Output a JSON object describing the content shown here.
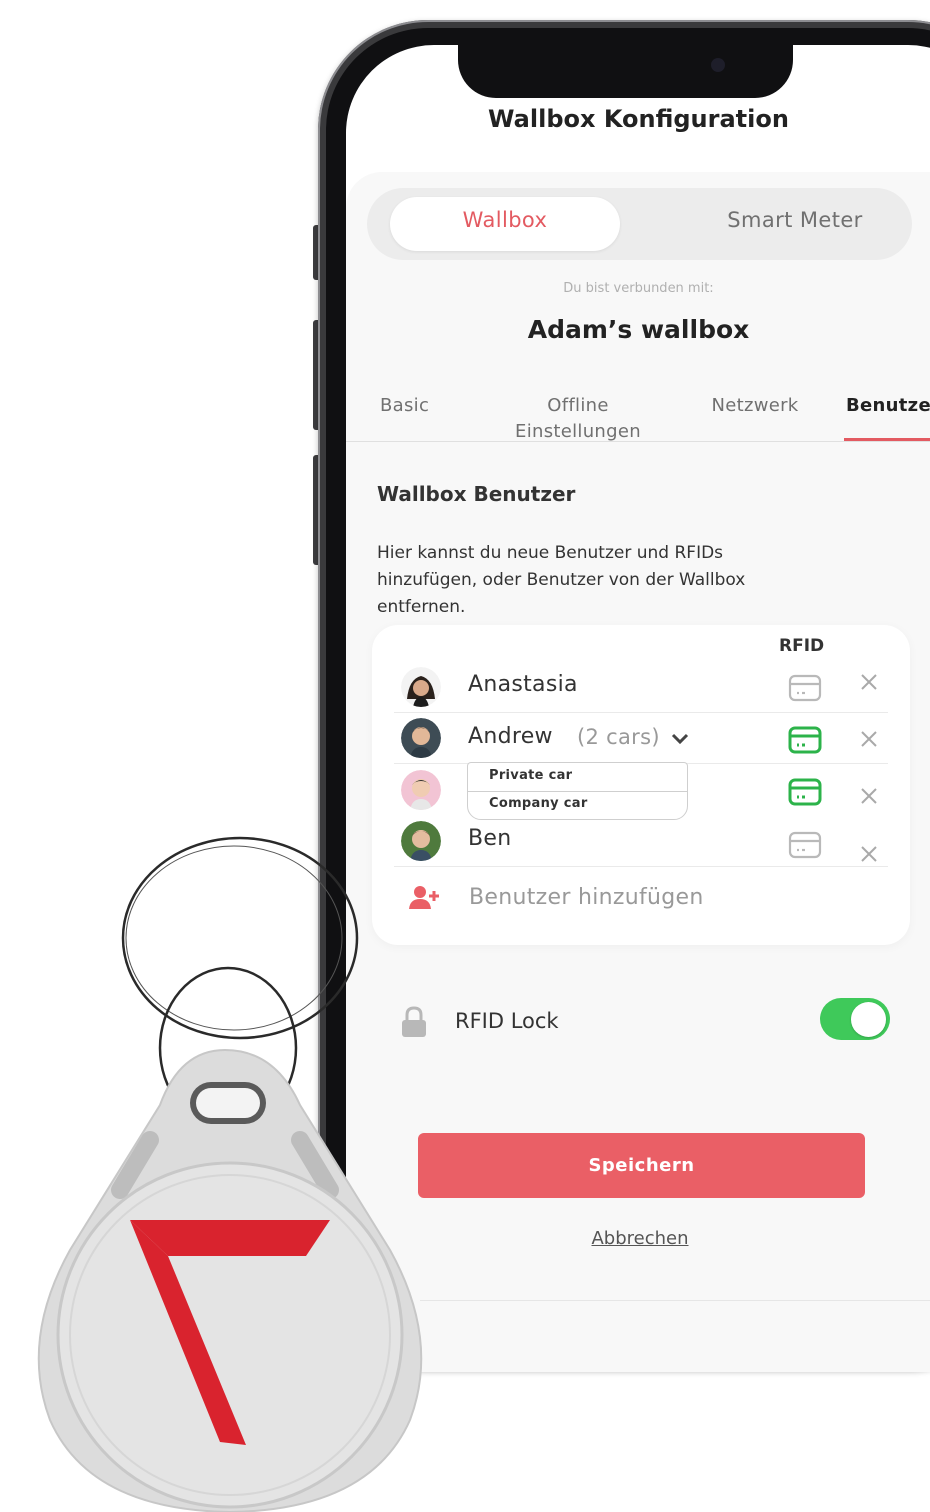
{
  "app": {
    "title": "Wallbox Konfiguration"
  },
  "segmented": {
    "items": [
      "Wallbox",
      "Smart Meter"
    ],
    "active": "Wallbox"
  },
  "connection": {
    "label": "Du bist verbunden mit:",
    "device_name": "Adam’s wallbox"
  },
  "tabs": [
    {
      "label": "Basic"
    },
    {
      "label": "Offline Einstellungen"
    },
    {
      "label": "Netzwerk"
    },
    {
      "label": "Benutze",
      "active": true
    }
  ],
  "section": {
    "title": "Wallbox Benutzer",
    "description": "Hier kannst du neue Benutzer und RFIDs hinzufügen, oder Benutzer von der Wallbox entfernen."
  },
  "users_table": {
    "rfid_header": "RFID",
    "users": [
      {
        "name": "Anastasia",
        "rfid_active": false
      },
      {
        "name": "Andrew",
        "cars": "(2 cars)",
        "rfid_active": true
      },
      {
        "name": "",
        "rfid_active": true
      },
      {
        "name": "Ben",
        "rfid_active": false
      }
    ],
    "car_options": [
      "Private car",
      "Company car"
    ],
    "add_user_label": "Benutzer hinzufügen"
  },
  "rfid_lock": {
    "label": "RFID Lock",
    "enabled": true
  },
  "actions": {
    "save": "Speichern",
    "cancel": "Abbrechen"
  },
  "colors": {
    "accent": "#ea5f66",
    "active_rfid": "#2cb34a",
    "toggle_on": "#3fc95a",
    "logo_red": "#d9232e"
  },
  "icons": [
    "card-icon",
    "close-icon",
    "chevron-down-icon",
    "add-user-icon",
    "lock-icon"
  ]
}
